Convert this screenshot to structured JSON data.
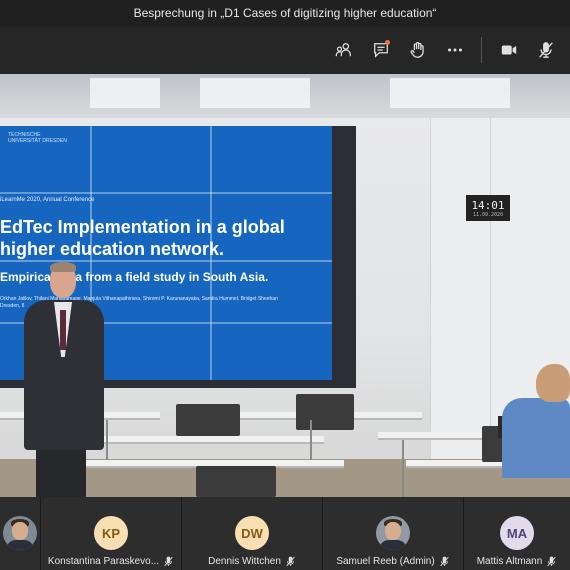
{
  "window": {
    "title": "Besprechung in „D1 Cases of digitizing higher education“"
  },
  "toolbar": {
    "icons": [
      "participants-icon",
      "chat-icon",
      "raise-hand-icon",
      "more-options-icon",
      "camera-icon",
      "mic-muted-icon"
    ],
    "chat_notification_color": "#e97548"
  },
  "slide": {
    "logo_text": "TECHNISCHE UNIVERSITÄT DRESDEN",
    "conference": "iLearnMe 2020, Annual Conference",
    "title": "EdTec Implementation in a global higher education network.",
    "subtitle": "Empirical data from a field study in South Asia.",
    "authors": "Orkhan Jalilov, Thilani Mahagamage, Manjula Vithanapathirana, Shiromi P. Karunanayaka, Sandra Hummel, Bridget Sheehan",
    "place": "Dresden, 8",
    "accent_color": "#1666c0"
  },
  "clock": {
    "time": "14:01",
    "date": "11.09.2020"
  },
  "participants": [
    {
      "name": "",
      "type": "photo",
      "muted": false
    },
    {
      "name": "Konstantina Paraskevo...",
      "initials": "KP",
      "type": "initials",
      "avatar_bg": "#f6dfb2",
      "avatar_fg": "#8a5a13",
      "muted": true
    },
    {
      "name": "Dennis Wittchen",
      "initials": "DW",
      "type": "initials",
      "avatar_bg": "#f6dfb2",
      "avatar_fg": "#8a5a13",
      "muted": true
    },
    {
      "name": "Samuel Reeb (Admin)",
      "type": "photo",
      "muted": true
    },
    {
      "name": "Mattis Altmann",
      "initials": "MA",
      "type": "initials",
      "avatar_bg": "#e2dbec",
      "avatar_fg": "#4f4277",
      "muted": true
    }
  ]
}
